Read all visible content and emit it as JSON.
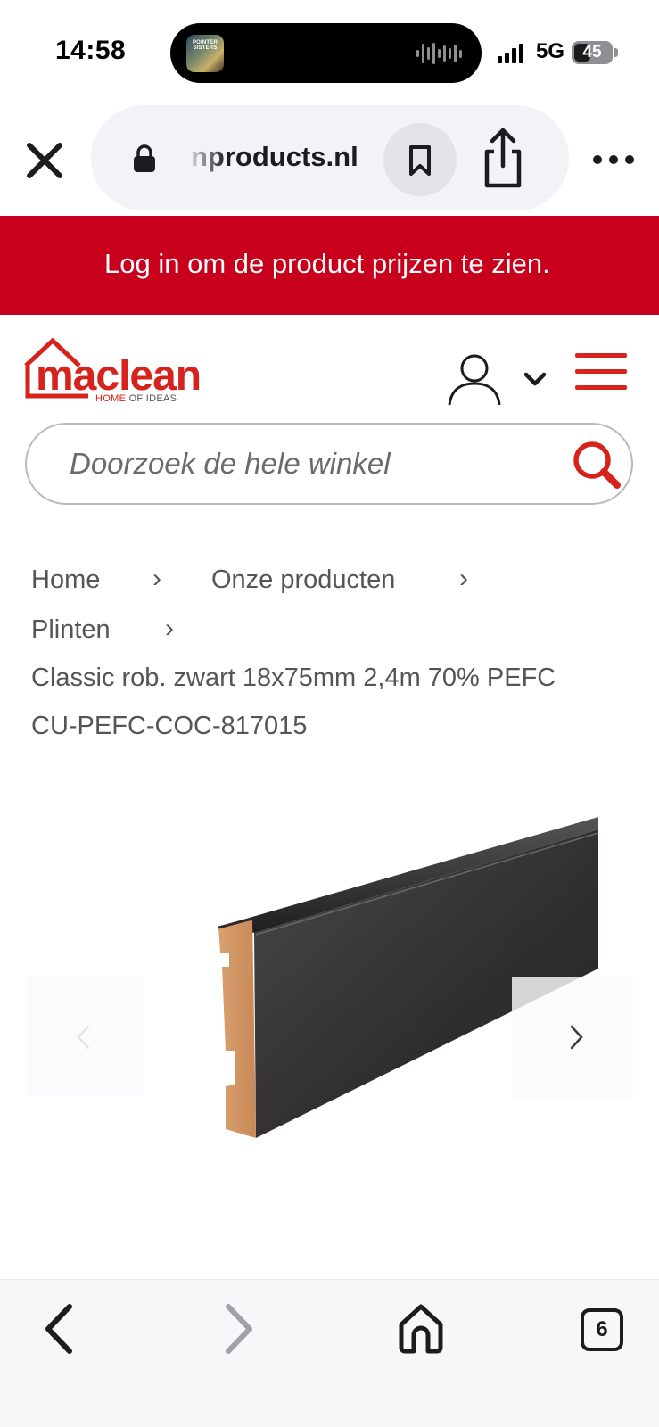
{
  "status_bar": {
    "time": "14:58",
    "now_playing_art_text": "POINTER SISTERS",
    "network": "5G",
    "battery_level": "45"
  },
  "browser": {
    "url": "nproducts.nl",
    "icons": {
      "close": "close-icon",
      "lock": "lock-icon",
      "bookmark": "bookmark-icon",
      "share": "share-icon",
      "more": "more-icon"
    }
  },
  "banner": {
    "text": "Log in om de product prijzen te zien."
  },
  "header": {
    "logo_word": "maclean",
    "logo_tagline_a": "HOME",
    "logo_tagline_b": "OF IDEAS",
    "search_placeholder": "Doorzoek de hele winkel",
    "brand_color": "#d6231c"
  },
  "breadcrumb": {
    "items": [
      "Home",
      "Onze producten",
      "Plinten"
    ],
    "current_line1": "Classic rob. zwart 18x75mm 2,4m 70% PEFC",
    "current_line2": "CU-PEFC-COC-817015",
    "separator": "›"
  },
  "gallery": {
    "image": "product-skirting-board-black",
    "prev": "chevron-left-icon",
    "next": "chevron-right-icon"
  },
  "bottom_nav": {
    "tab_count": "6"
  },
  "colors": {
    "banner": "#c8001c",
    "accent": "#d6231c",
    "text": "#555555"
  }
}
